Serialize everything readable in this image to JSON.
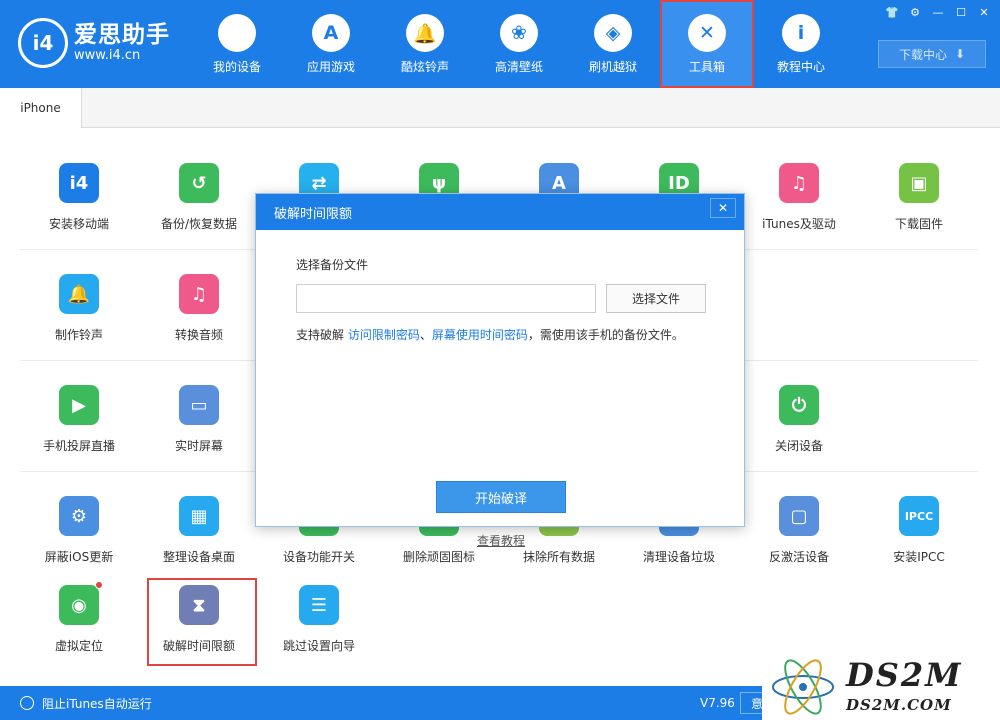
{
  "header": {
    "logo_badge": "i4",
    "logo_name": "爱思助手",
    "logo_url": "www.i4.cn",
    "nav": [
      {
        "label": "我的设备",
        "icon": "apple-icon",
        "glyph": ""
      },
      {
        "label": "应用游戏",
        "icon": "app-store-icon",
        "glyph": "A"
      },
      {
        "label": "酷炫铃声",
        "icon": "bell-icon",
        "glyph": "🔔"
      },
      {
        "label": "高清壁纸",
        "icon": "flower-icon",
        "glyph": "❀"
      },
      {
        "label": "刷机越狱",
        "icon": "dropbox-icon",
        "glyph": "◈"
      },
      {
        "label": "工具箱",
        "icon": "tools-icon",
        "glyph": "✕",
        "active": true
      },
      {
        "label": "教程中心",
        "icon": "info-icon",
        "glyph": "i"
      }
    ],
    "window_controls": [
      "👕",
      "⚙",
      "—",
      "☐",
      "✕"
    ],
    "download_label": "下载中心",
    "download_icon": "⬇"
  },
  "tabs": [
    {
      "label": "iPhone"
    }
  ],
  "tools": [
    {
      "label": "安装移动端",
      "icon": "i4-app-icon",
      "color": "#1d7de6",
      "glyph": "i4"
    },
    {
      "label": "备份/恢复数据",
      "icon": "backup-clock-icon",
      "color": "#3dbb5c",
      "glyph": "↺"
    },
    {
      "label": "",
      "icon": "transfer-icon",
      "color": "#26b0ee",
      "glyph": "⇄"
    },
    {
      "label": "",
      "icon": "usb-icon",
      "color": "#3dbb5c",
      "glyph": "ψ"
    },
    {
      "label": "",
      "icon": "app-store-icon",
      "color": "#4a8fe0",
      "glyph": "A"
    },
    {
      "label": "",
      "icon": "apple-id-icon",
      "color": "#3dbb5c",
      "glyph": "ID"
    },
    {
      "label": "iTunes及驱动",
      "icon": "itunes-icon",
      "color": "#ef5a8a",
      "glyph": "♫"
    },
    {
      "label": "下载固件",
      "icon": "cube-icon",
      "color": "#76c244",
      "glyph": "▣"
    },
    {
      "label": "制作铃声",
      "icon": "bell-plus-icon",
      "color": "#26a9ee",
      "glyph": "🔔"
    },
    {
      "label": "转换音频",
      "icon": "music-icon",
      "color": "#ef5a8a",
      "glyph": "♫"
    },
    {
      "label": "手机投屏直播",
      "icon": "screen-cast-icon",
      "color": "#3dbb5c",
      "glyph": "▶"
    },
    {
      "label": "实时屏幕",
      "icon": "monitor-icon",
      "color": "#5a8fdc",
      "glyph": "▭"
    },
    {
      "label": "关闭设备",
      "icon": "power-icon",
      "color": "#3dbb5c",
      "glyph": "⏻"
    },
    {
      "label": "屏蔽iOS更新",
      "icon": "gear-block-icon",
      "color": "#4a8fe0",
      "glyph": "⚙"
    },
    {
      "label": "整理设备桌面",
      "icon": "grid-icon",
      "color": "#26a9ee",
      "glyph": "▦"
    },
    {
      "label": "设备功能开关",
      "icon": "switch-icon",
      "color": "#3dbb5c",
      "glyph": ""
    },
    {
      "label": "删除顽固图标",
      "icon": "delete-icon",
      "color": "#3dbb5c",
      "glyph": ""
    },
    {
      "label": "抹除所有数据",
      "icon": "erase-icon",
      "color": "#8bc34a",
      "glyph": ""
    },
    {
      "label": "清理设备垃圾",
      "icon": "broom-icon",
      "color": "#4a8fe0",
      "glyph": ""
    },
    {
      "label": "反激活设备",
      "icon": "tablet-icon",
      "color": "#5a8fdc",
      "glyph": "▢"
    },
    {
      "label": "安装IPCC",
      "icon": "ipcc-icon",
      "color": "#26a9ee",
      "glyph": "IPCC"
    },
    {
      "label": "虚拟定位",
      "icon": "location-pin-icon",
      "color": "#3dbb5c",
      "glyph": "◉"
    },
    {
      "label": "破解时间限额",
      "icon": "hourglass-icon",
      "color": "#6f7fb6",
      "glyph": "⧗"
    },
    {
      "label": "跳过设置向导",
      "icon": "skip-wizard-icon",
      "color": "#26a9ee",
      "glyph": "☰"
    }
  ],
  "modal": {
    "title": "破解时间限额",
    "close": "✕",
    "field_label": "选择备份文件",
    "file_value": "",
    "choose_label": "选择文件",
    "hint_prefix": "支持破解 ",
    "hint_link1": "访问限制密码",
    "hint_sep": "、",
    "hint_link2": "屏幕使用时间密码",
    "hint_suffix": "，需使用该手机的备份文件。",
    "start_label": "开始破译",
    "tutorial_label": "查看教程"
  },
  "statusbar": {
    "block_itunes": "阻止iTunes自动运行",
    "version": "V7.96",
    "feedback": "意"
  },
  "watermark": {
    "big": "DS2M",
    "small": "DS2M.COM"
  }
}
